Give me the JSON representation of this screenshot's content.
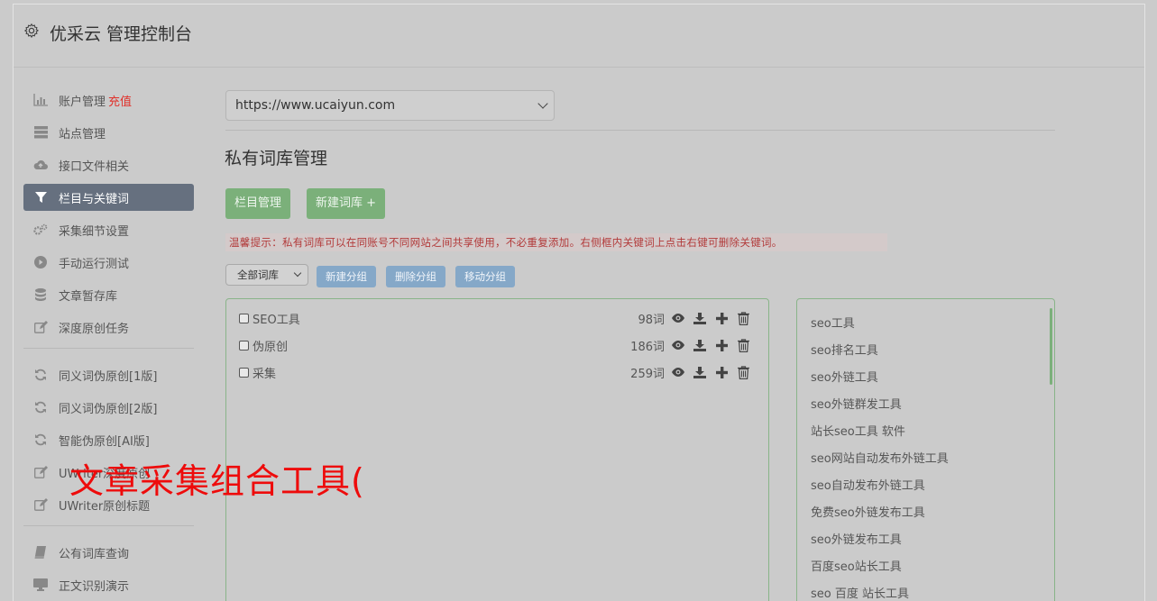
{
  "header": {
    "title": "优采云 管理控制台"
  },
  "sidebar": {
    "group1": [
      {
        "label": "账户管理",
        "extra": "充值",
        "icon": "bar-chart-icon"
      },
      {
        "label": "站点管理",
        "icon": "server-icon"
      },
      {
        "label": "接口文件相关",
        "icon": "cloud-upload-icon"
      },
      {
        "label": "栏目与关键词",
        "icon": "filter-icon",
        "active": true
      },
      {
        "label": "采集细节设置",
        "icon": "cogs-icon"
      },
      {
        "label": "手动运行测试",
        "icon": "play-circle-icon"
      },
      {
        "label": "文章暂存库",
        "icon": "database-icon"
      },
      {
        "label": "深度原创任务",
        "icon": "edit-icon"
      }
    ],
    "group2": [
      {
        "label": "同义词伪原创[1版]",
        "icon": "refresh-icon"
      },
      {
        "label": "同义词伪原创[2版]",
        "icon": "refresh-icon"
      },
      {
        "label": "智能伪原创[AI版]",
        "icon": "refresh-icon"
      },
      {
        "label": "UWriter深度原创",
        "icon": "edit-icon"
      },
      {
        "label": "UWriter原创标题",
        "icon": "edit-icon"
      }
    ],
    "group3": [
      {
        "label": "公有词库查询",
        "icon": "book-icon"
      },
      {
        "label": "正文识别演示",
        "icon": "desktop-icon"
      }
    ]
  },
  "main": {
    "site_select": "https://www.ucaiyun.com",
    "page_title": "私有词库管理",
    "buttons": {
      "column_manage": "栏目管理",
      "new_library": "新建词库 +"
    },
    "tip": "温馨提示：私有词库可以在同账号不同网站之间共享使用，不必重复添加。右侧框内关键词上点击右键可删除关键词。",
    "group_select": "全部词库",
    "group_buttons": {
      "new_group": "新建分组",
      "delete_group": "删除分组",
      "move_group": "移动分组"
    },
    "libraries": [
      {
        "name": "SEO工具",
        "count": "98词"
      },
      {
        "name": "伪原创",
        "count": "186词"
      },
      {
        "name": "采集",
        "count": "259词"
      }
    ],
    "keywords": [
      "seo工具",
      "seo排名工具",
      "seo外链工具",
      "seo外链群发工具",
      "站长seo工具 软件",
      "seo网站自动发布外链工具",
      "seo自动发布外链工具",
      "免费seo外链发布工具",
      "seo外链发布工具",
      "百度seo站长工具",
      "seo 百度 站长工具"
    ]
  },
  "overlay_text": "文章采集组合工具("
}
